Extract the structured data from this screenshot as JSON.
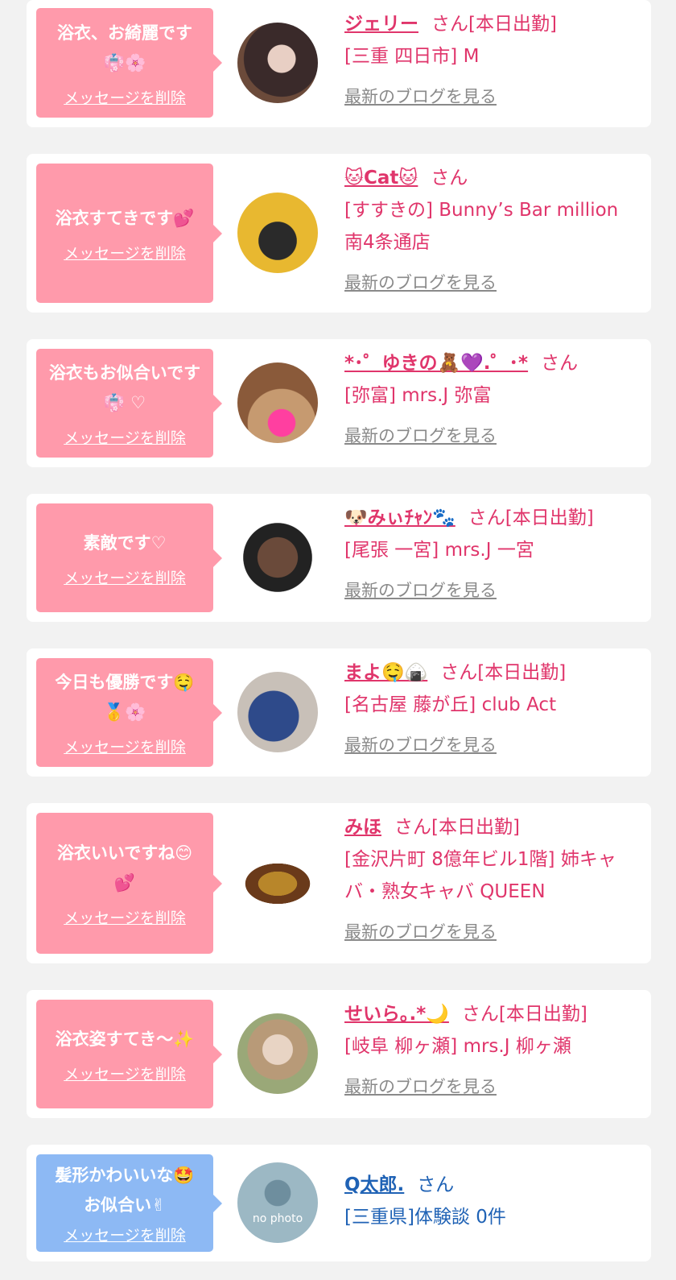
{
  "delete_label": "メッセージを削除",
  "blog_label": "最新のブログを見る",
  "items": [
    {
      "message": "浴衣、お綺麗です 👘🌸",
      "name": "ジェリー",
      "suffix": "さん[本日出勤]",
      "shop": "[三重 四日市] M"
    },
    {
      "message": "浴衣すてきです💕",
      "name": "🐱Cat🐱",
      "suffix": "さん",
      "shop": "[すすきの] Bunny’s Bar million 南4条通店"
    },
    {
      "message": "浴衣もお似合いです👘 ♡",
      "name": "*･゜ゆきの🧸💜.゜･*",
      "suffix": "さん",
      "shop": "[弥富] mrs.J 弥富"
    },
    {
      "message": "素敵です♡",
      "name": "🐶みぃﾁｬﾝ🐾",
      "suffix": "さん[本日出勤]",
      "shop": "[尾張 一宮] mrs.J 一宮"
    },
    {
      "message": "今日も優勝です🤤🥇🌸",
      "name": "まよ🤤🍙",
      "suffix": "さん[本日出勤]",
      "shop": "[名古屋 藤が丘] club Act"
    },
    {
      "message": "浴衣いいですね😊💕",
      "name": "みほ",
      "suffix": "さん[本日出勤]",
      "shop": "[金沢片町 8億年ビル1階] 姉キャバ・熟女キャバ QUEEN"
    },
    {
      "message": "浴衣姿すてき〜✨",
      "name": "せいら｡.*🌙",
      "suffix": "さん[本日出勤]",
      "shop": "[岐阜 柳ヶ瀬] mrs.J 柳ヶ瀬"
    },
    {
      "message": "髪形かわいいな🤩お似合い✌",
      "name": "Q太郎.",
      "suffix": "さん",
      "shop": "[三重県]体験談 0件",
      "avatar_text": "no photo"
    }
  ]
}
